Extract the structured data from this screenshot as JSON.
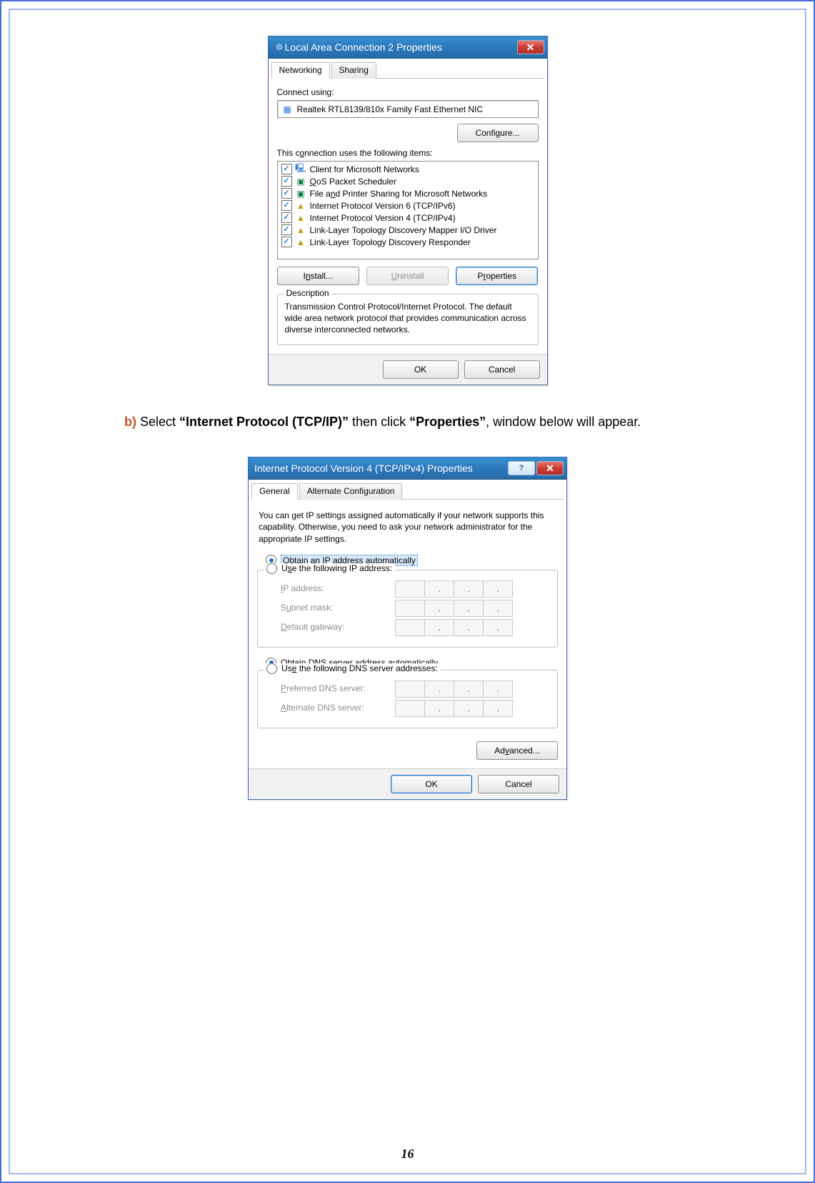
{
  "page_number": "16",
  "instruction": {
    "step_label": "b)",
    "pre": " Select ",
    "bold1": "“Internet Protocol (TCP/IP)”",
    "mid": " then click ",
    "bold2": "“Properties”",
    "post": ", window below will appear."
  },
  "dialog1": {
    "title": "Local Area Connection 2 Properties",
    "tabs": {
      "networking": "Networking",
      "sharing": "Sharing"
    },
    "connect_using_label": "Connect using:",
    "adapter": "Realtek RTL8139/810x Family Fast Ethernet NIC",
    "configure_btn": "Configure...",
    "items_label": "This connection uses the following items:",
    "items": [
      {
        "label": "Client for Microsoft Networks",
        "icon": "client",
        "selected": false
      },
      {
        "label": "QoS Packet Scheduler",
        "icon": "qos",
        "selected": false
      },
      {
        "label": "File and Printer Sharing for Microsoft Networks",
        "icon": "share",
        "selected": false
      },
      {
        "label": "Internet Protocol Version 6 (TCP/IPv6)",
        "icon": "proto",
        "selected": false
      },
      {
        "label": "Internet Protocol Version 4 (TCP/IPv4)",
        "icon": "proto",
        "selected": true
      },
      {
        "label": "Link-Layer Topology Discovery Mapper I/O Driver",
        "icon": "proto",
        "selected": false
      },
      {
        "label": "Link-Layer Topology Discovery Responder",
        "icon": "proto",
        "selected": false
      }
    ],
    "install_btn": "Install...",
    "uninstall_btn": "Uninstall",
    "properties_btn": "Properties",
    "description_label": "Description",
    "description_text": "Transmission Control Protocol/Internet Protocol. The default wide area network protocol that provides communication across diverse interconnected networks.",
    "ok_btn": "OK",
    "cancel_btn": "Cancel"
  },
  "dialog2": {
    "title": "Internet Protocol Version 4 (TCP/IPv4) Properties",
    "tabs": {
      "general": "General",
      "altconfig": "Alternate Configuration"
    },
    "help_text": "You can get IP settings assigned automatically if your network supports this capability. Otherwise, you need to ask your network administrator for the appropriate IP settings.",
    "radio_ip_auto": "Obtain an IP address automatically",
    "radio_ip_manual": "Use the following IP address:",
    "field_ip": "IP address:",
    "field_subnet": "Subnet mask:",
    "field_gateway": "Default gateway:",
    "radio_dns_auto": "Obtain DNS server address automatically",
    "radio_dns_manual": "Use the following DNS server addresses:",
    "field_pref_dns": "Preferred DNS server:",
    "field_alt_dns": "Alternate DNS server:",
    "advanced_btn": "Advanced...",
    "ok_btn": "OK",
    "cancel_btn": "Cancel"
  }
}
